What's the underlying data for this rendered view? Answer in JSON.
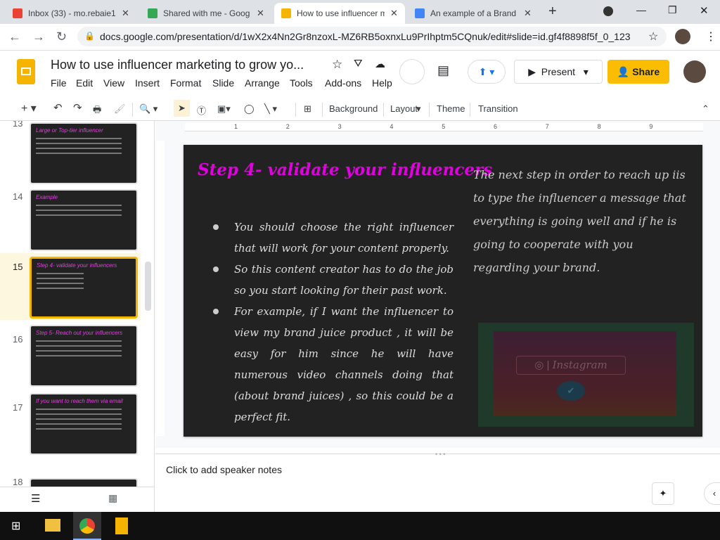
{
  "browser": {
    "tabs": [
      {
        "label": "Inbox (33) - mo.rebaie1",
        "color": "#ea4335"
      },
      {
        "label": "Shared with me - Goog",
        "color": "#34a853"
      },
      {
        "label": "How to use influencer m",
        "color": "#f4b400"
      },
      {
        "label": "An example of a Brand",
        "color": "#4285f4"
      }
    ],
    "url": "docs.google.com/presentation/d/1wX2x4Nn2Gr8nzoxL-MZ6RB5oxnxLu9PrIhptm5CQnuk/edit#slide=id.gf4f8898f5f_0_123"
  },
  "app": {
    "title": "How to use influencer marketing to grow yo...",
    "menu": [
      "File",
      "Edit",
      "View",
      "Insert",
      "Format",
      "Slide",
      "Arrange",
      "Tools",
      "Add-ons",
      "Help"
    ],
    "present": "Present",
    "share": "Share"
  },
  "toolbar": {
    "background": "Background",
    "layout": "Layout",
    "theme": "Theme",
    "transition": "Transition"
  },
  "ruler": [
    "1",
    "2",
    "3",
    "4",
    "5",
    "6",
    "7",
    "8",
    "9"
  ],
  "filmstrip": [
    {
      "num": "13",
      "title": "Large or Top-tier influencer"
    },
    {
      "num": "14",
      "title": "Example"
    },
    {
      "num": "15",
      "title": "Step 4- validate your influencers"
    },
    {
      "num": "16",
      "title": "Step 5- Reach out your influencers"
    },
    {
      "num": "17",
      "title": "If you want to reach them via email"
    },
    {
      "num": "18",
      "title": ""
    }
  ],
  "slide": {
    "title": "Step 4- validate your influencers",
    "bullets": [
      "You should choose the right influencer that will work for your content properly.",
      "So this content creator has to do the job so you start looking for their past work.",
      "For example, if I want the influencer to view my brand juice product , it will be easy for him since he will have numerous video channels doing that (about brand juices) , so this could be a perfect fit."
    ],
    "right_text": "The next step in order to reach up iis to type the influencer a message that everything is going well and if he is going to cooperate with you regarding your brand.",
    "image_text": "Instagram"
  },
  "notes": {
    "placeholder": "Click to add speaker notes"
  },
  "colors": {
    "title": "#e000e0",
    "share": "#fbbc04",
    "selected": "#f4b400"
  }
}
